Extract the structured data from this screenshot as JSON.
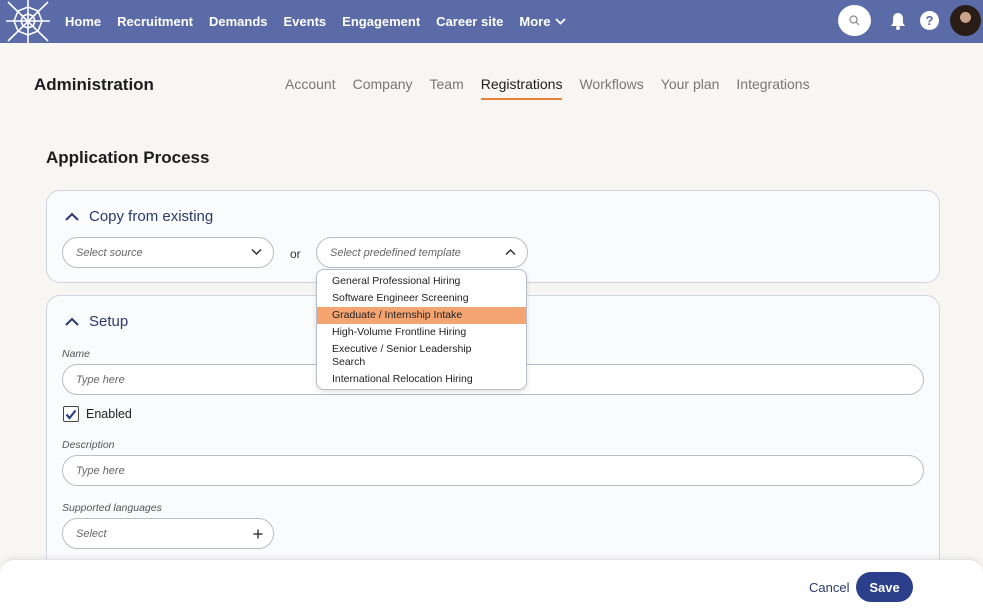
{
  "topnav": {
    "items": [
      "Home",
      "Recruitment",
      "Demands",
      "Events",
      "Engagement",
      "Career site"
    ],
    "more_label": "More",
    "help_label": "?"
  },
  "admin": {
    "title": "Administration",
    "tabs": [
      {
        "label": "Account",
        "active": false
      },
      {
        "label": "Company",
        "active": false
      },
      {
        "label": "Team",
        "active": false
      },
      {
        "label": "Registrations",
        "active": true
      },
      {
        "label": "Workflows",
        "active": false
      },
      {
        "label": "Your plan",
        "active": false
      },
      {
        "label": "Integrations",
        "active": false
      }
    ]
  },
  "section": {
    "title": "Application Process"
  },
  "copy_card": {
    "title": "Copy from existing",
    "source_placeholder": "Select source",
    "or_label": "or",
    "template_placeholder": "Select predefined template",
    "template_options": [
      "General Professional Hiring",
      "Software Engineer Screening",
      "Graduate / Internship Intake",
      "High-Volume Frontline Hiring",
      "Executive / Senior Leadership Search",
      "International Relocation Hiring"
    ],
    "highlighted_option": "Graduate / Internship Intake"
  },
  "setup_card": {
    "title": "Setup",
    "name_label": "Name",
    "name_placeholder": "Type here",
    "enabled_label": "Enabled",
    "enabled": true,
    "description_label": "Description",
    "description_placeholder": "Type here",
    "languages_label": "Supported languages",
    "languages_placeholder": "Select"
  },
  "footer": {
    "cancel_label": "Cancel",
    "save_label": "Save"
  },
  "colors": {
    "nav": "#5a6ba8",
    "accent": "#e8833a",
    "primary": "#2b3f8a",
    "highlight": "#f3a470"
  }
}
